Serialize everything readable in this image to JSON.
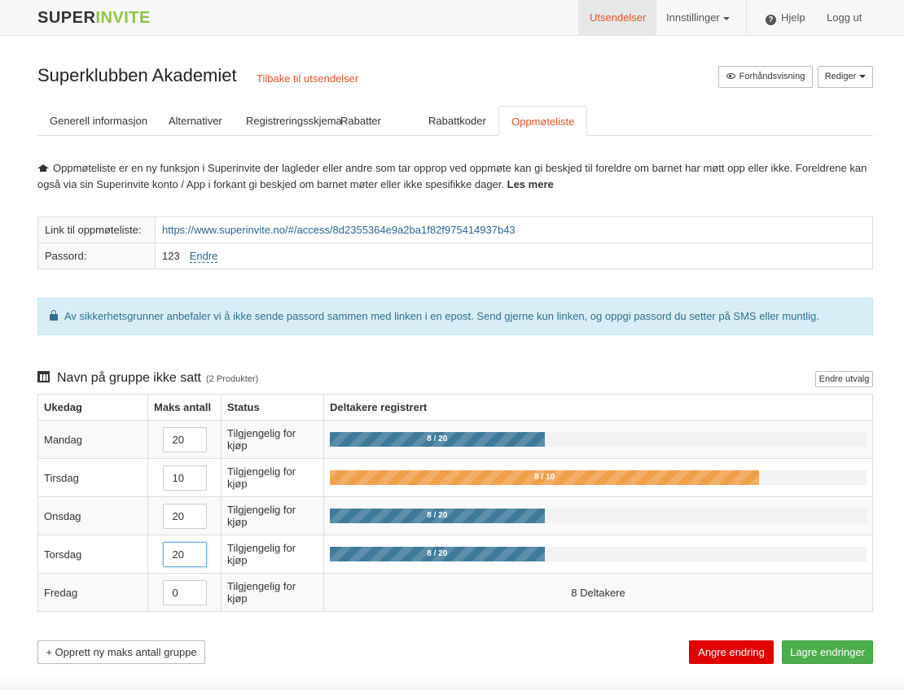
{
  "app": {
    "logo_part1": "SUPER",
    "logo_part2": "INVITE",
    "brand_color": "#8cc63f",
    "accent_color": "#e8532a"
  },
  "nav": {
    "utsendelser": "Utsendelser",
    "innstillinger": "Innstillinger",
    "hjelp": "Hjelp",
    "logout": "Logg ut"
  },
  "page": {
    "title": "Superklubben Akademiet",
    "back_link": "Tilbake til utsendelser",
    "preview_button": "Forhåndsvisning",
    "edit_button": "Rediger"
  },
  "tabs": [
    {
      "label": "Generell informasjon"
    },
    {
      "label": "Alternativer"
    },
    {
      "label": "Registreringsskjema"
    },
    {
      "label": "Rabatter"
    },
    {
      "label": "Rabattkoder"
    },
    {
      "label": "Oppmøteliste",
      "active": true
    }
  ],
  "info": {
    "text": "Oppmøteliste er en ny funksjon i Superinvite der lagleder eller andre som tar opprop ved oppmøte kan gi beskjed til foreldre om barnet har møtt opp eller ikke. Foreldrene kan også via sin Superinvite konto / App i forkant gi beskjed om barnet møter eller ikke spesifikke dager.",
    "read_more": "Les mere"
  },
  "access": {
    "link_label": "Link til oppmøteliste:",
    "link_url": "https://www.superinvite.no/#/access/8d2355364e9a2ba1f82f975414937b43",
    "password_label": "Passord:",
    "password_value": "123",
    "password_change": "Endre"
  },
  "alert": {
    "text": "Av sikkerhetsgrunner anbefaler vi å ikke sende passord sammen med linken i en epost. Send gjerne kun linken, og oppgi passord du setter på SMS eller muntlig."
  },
  "group": {
    "title": "Navn på gruppe ikke satt",
    "count": "(2 Produkter)",
    "change_selection": "Endre utvalg",
    "columns": [
      "Ukedag",
      "Maks antall",
      "Status",
      "Deltakere registrert"
    ],
    "rows": [
      {
        "day": "Mandag",
        "max": "20",
        "status": "Tilgjengelig for kjøp",
        "bar_label": "8 / 20",
        "fill": 0.4,
        "color": "blue"
      },
      {
        "day": "Tirsdag",
        "max": "10",
        "status": "Tilgjengelig for kjøp",
        "bar_label": "8 / 10",
        "fill": 0.8,
        "color": "orange"
      },
      {
        "day": "Onsdag",
        "max": "20",
        "status": "Tilgjengelig for kjøp",
        "bar_label": "8 / 20",
        "fill": 0.4,
        "color": "blue"
      },
      {
        "day": "Torsdag",
        "max": "20",
        "status": "Tilgjengelig for kjøp",
        "bar_label": "8 / 20",
        "fill": 0.4,
        "color": "blue",
        "focused": true
      },
      {
        "day": "Fredag",
        "max": "0",
        "status": "Tilgjengelig for kjøp",
        "participants_text": "8 Deltakere"
      }
    ]
  },
  "actions": {
    "new_group": "+ Opprett ny maks antall gruppe",
    "undo": "Angre endring",
    "save": "Lagre endringer",
    "undo_color": "#e00000",
    "save_color": "#4cae4c"
  }
}
